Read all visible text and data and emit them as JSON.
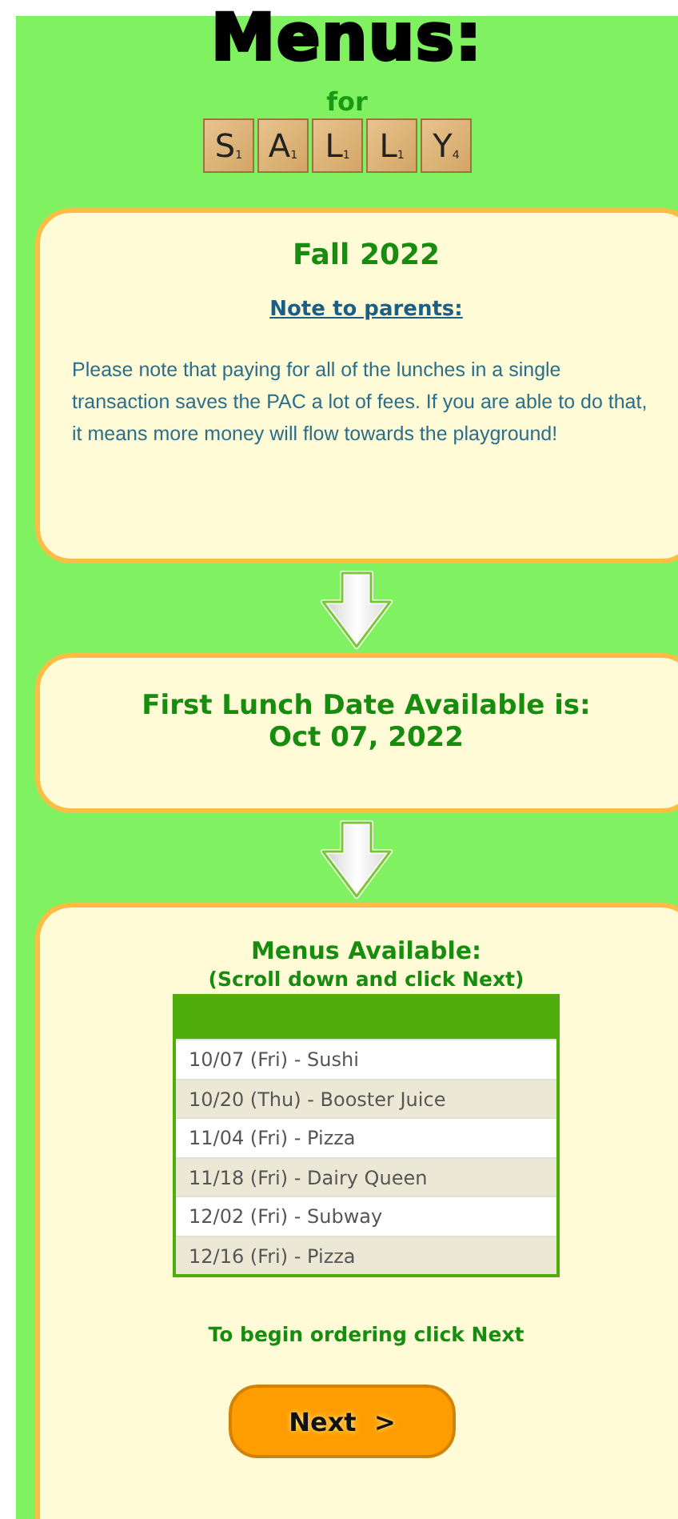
{
  "header": {
    "title": "Menus:",
    "subtitle": "for",
    "tiles": [
      {
        "letter": "S",
        "points": "1"
      },
      {
        "letter": "A",
        "points": "1"
      },
      {
        "letter": "L",
        "points": "1"
      },
      {
        "letter": "L",
        "points": "1"
      },
      {
        "letter": "Y",
        "points": "4"
      }
    ]
  },
  "season_card": {
    "title": "Fall 2022",
    "note_heading": "Note to parents:",
    "note": "Please note that paying for all of the lunches in a single transaction saves the PAC a lot of fees.  If you are able to do that, it means more money will flow towards the playground!"
  },
  "date_card": {
    "lines": [
      "First Lunch Date Available is:",
      "Oct 07, 2022"
    ]
  },
  "menus_card": {
    "title": "Menus Available:",
    "hint": "(Scroll down and click Next)",
    "menus": [
      {
        "label": "10/07 (Fri) - Sushi"
      },
      {
        "label": "10/20 (Thu) - Booster Juice"
      },
      {
        "label": "11/04 (Fri) - Pizza"
      },
      {
        "label": "11/18 (Fri) - Dairy Queen"
      },
      {
        "label": "12/02 (Fri) - Subway"
      },
      {
        "label": "12/16 (Fri) - Pizza"
      }
    ],
    "instruction": "To begin ordering click Next",
    "button": "Next  >"
  }
}
